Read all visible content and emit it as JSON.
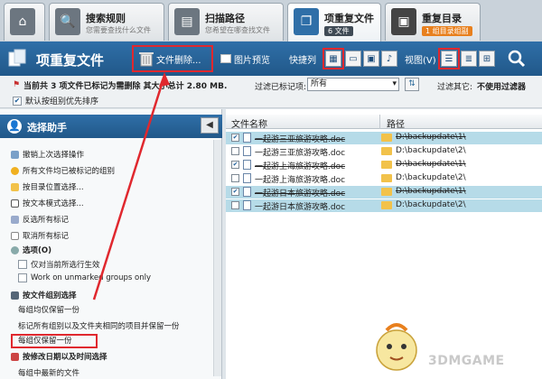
{
  "tabs": [
    {
      "title": "",
      "sub": "",
      "icon": "home-icon"
    },
    {
      "title": "搜索规则",
      "sub": "您需要查找什么文件",
      "icon": "search-icon"
    },
    {
      "title": "扫描路径",
      "sub": "您希望在哪查找文件",
      "icon": "scan-icon"
    },
    {
      "title": "项重复文件",
      "badge": "6 文件",
      "icon": "duplicate-icon"
    },
    {
      "title": "重复目录",
      "badge": "1 组目录组副",
      "icon": "folder-icon"
    }
  ],
  "toolbar": {
    "title": "项重复文件",
    "delete_label": "文件删除...",
    "preview_label": "图片预览",
    "quicklist_label": "快捷列",
    "view_label": "视图(V)"
  },
  "status": {
    "summary": "当前共 3 项文件已标记为需删除   其大小总计 2.80 MB.",
    "priority_label": "默认按组别优先排序",
    "marked_filter_label": "过滤已标记项:",
    "marked_filter_value": "所有",
    "other_filter_label": "过滤其它:",
    "other_filter_value": "不使用过滤器"
  },
  "helper": {
    "title": "选择助手",
    "items": [
      "撤销上次选择操作",
      "所有文件均已被标记的组别",
      "按目录位置选择...",
      "按文本模式选择...",
      "反选所有标记",
      "取消所有标记",
      "选项(O)",
      "仅对当前所选行生效",
      "Work on unmarked groups only",
      "按文件组别选择",
      "每组均仅保留一份",
      "标记所有组别以及文件夹相同的项目并保留一份",
      "每组仅保留一份",
      "按修改日期以及时间选择",
      "每组中最新的文件"
    ]
  },
  "table": {
    "col_name": "文件名称",
    "col_path": "路径",
    "rows": [
      {
        "name": "一起游三亚旅游攻略.doc",
        "path": "D:\\backupdate\\1\\",
        "checked": true,
        "selected": true,
        "strike": true
      },
      {
        "name": "一起游三亚旅游攻略.doc",
        "path": "D:\\backupdate\\2\\",
        "checked": false,
        "selected": false,
        "strike": false
      },
      {
        "name": "一起游上海旅游攻略.doc",
        "path": "D:\\backupdate\\1\\",
        "checked": true,
        "selected": false,
        "strike": true
      },
      {
        "name": "一起游上海旅游攻略.doc",
        "path": "D:\\backupdate\\2\\",
        "checked": false,
        "selected": false,
        "strike": false
      },
      {
        "name": "一起游日本旅游攻略.doc",
        "path": "D:\\backupdate\\1\\",
        "checked": true,
        "selected": true,
        "strike": true
      },
      {
        "name": "一起游日本旅游攻略.doc",
        "path": "D:\\backupdate\\2\\",
        "checked": false,
        "selected": true,
        "strike": false
      }
    ]
  },
  "watermark": "3DMGAME",
  "colors": {
    "toolbar_blue": "#2a679f",
    "highlight_red": "#e0282e",
    "selected_row": "#b6dbe8"
  }
}
